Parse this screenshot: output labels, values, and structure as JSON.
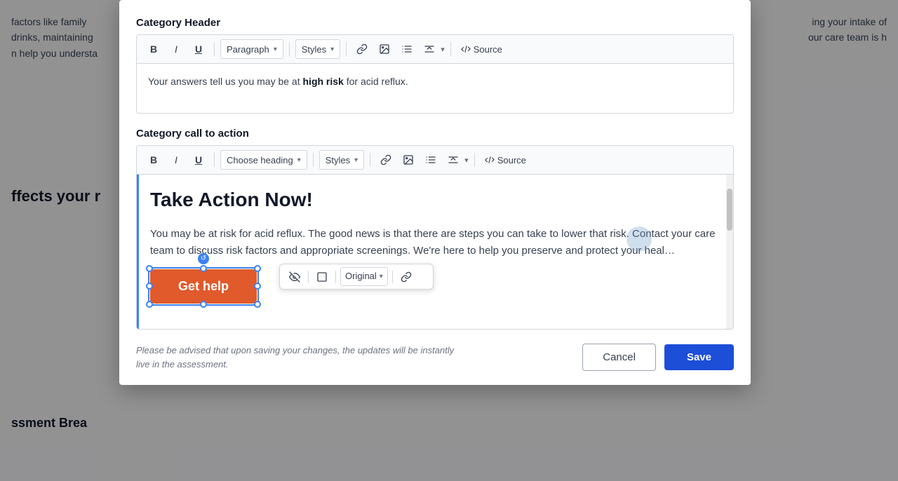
{
  "background": {
    "left_text_lines": [
      "factors like family",
      "drinks, maintaining",
      "n help you understa"
    ],
    "right_text_lines": [
      "ing your intake of",
      "our care team is h"
    ],
    "left_heading": "ffects your r",
    "left_heading2": "ssment Brea"
  },
  "modal": {
    "section1": {
      "label": "Category Header",
      "toolbar": {
        "bold": "B",
        "italic": "I",
        "underline": "U",
        "paragraph": "Paragraph",
        "styles": "Styles",
        "source": "Source"
      },
      "content": {
        "text_before": "Your answers tell us you may be at ",
        "text_bold": "high risk",
        "text_after": " for acid reflux."
      }
    },
    "section2": {
      "label": "Category call to action",
      "toolbar": {
        "bold": "B",
        "italic": "I",
        "underline": "U",
        "heading": "Choose heading",
        "styles": "Styles",
        "source": "Source"
      },
      "content": {
        "heading": "Take Action Now!",
        "paragraph": "You may be at risk for acid reflux. The good news is that there are steps you can take to lower that risk. Contact your care team to discuss risk factors and appropriate screenings. We're here to help you preserve and protect your heal…",
        "button_text": "Get help"
      }
    },
    "floating_toolbar": {
      "original": "Original",
      "link": "🔗"
    },
    "footer": {
      "advisory": "Please be advised that upon saving your changes, the updates will be instantly live in the assessment.",
      "cancel": "Cancel",
      "save": "Save"
    }
  }
}
